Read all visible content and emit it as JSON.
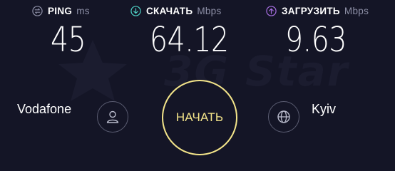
{
  "watermark": "3G Star",
  "metrics": {
    "ping": {
      "label": "PING",
      "unit": "ms",
      "value": "45",
      "icon": "ping-icon",
      "color": "#8d8fa6"
    },
    "download": {
      "label": "СКАЧАТЬ",
      "unit": "Mbps",
      "value": "64.12",
      "icon": "download-arrow-icon",
      "color": "#4fd1c5"
    },
    "upload": {
      "label": "ЗАГРУЗИТЬ",
      "unit": "Mbps",
      "value": "9.63",
      "icon": "upload-arrow-icon",
      "color": "#a66ee0"
    }
  },
  "isp": {
    "name": "Vodafone",
    "icon": "user-icon"
  },
  "server": {
    "name": "Kyiv",
    "icon": "globe-icon"
  },
  "go_button": {
    "label": "НАЧАТЬ",
    "color": "#f4e58a"
  }
}
